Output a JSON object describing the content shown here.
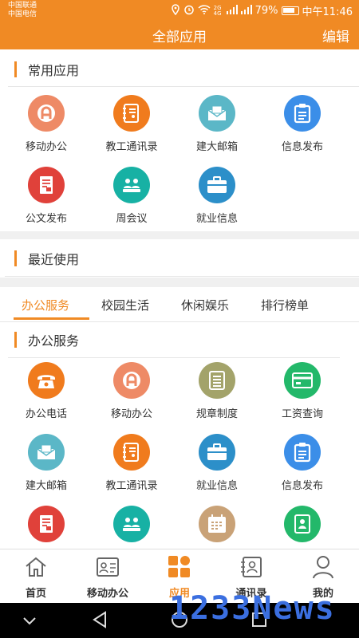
{
  "status": {
    "carrier1": "中国联通",
    "carrier2": "中国电信",
    "signal_tags": "2G 4G",
    "battery": "79%",
    "time": "中午11:46"
  },
  "header": {
    "title": "全部应用",
    "edit_label": "编辑"
  },
  "common": {
    "title": "常用应用",
    "apps": [
      {
        "label": "移动办公",
        "icon": "mobile-office-icon",
        "color": "#ee8a66"
      },
      {
        "label": "教工通讯录",
        "icon": "contacts-book-icon",
        "color": "#f07b1d"
      },
      {
        "label": "建大邮箱",
        "icon": "mail-icon",
        "color": "#5bb7c7"
      },
      {
        "label": "信息发布",
        "icon": "clipboard-icon",
        "color": "#3b8ee8"
      },
      {
        "label": "公文发布",
        "icon": "document-icon",
        "color": "#e0413a"
      },
      {
        "label": "周会议",
        "icon": "meeting-icon",
        "color": "#17b1a4"
      },
      {
        "label": "就业信息",
        "icon": "briefcase-icon",
        "color": "#2c8fc9"
      }
    ]
  },
  "recent": {
    "title": "最近使用"
  },
  "tabs": [
    {
      "label": "办公服务",
      "active": true
    },
    {
      "label": "校园生活",
      "active": false
    },
    {
      "label": "休闲娱乐",
      "active": false
    },
    {
      "label": "排行榜单",
      "active": false
    }
  ],
  "office": {
    "title": "办公服务",
    "apps": [
      {
        "label": "办公电话",
        "icon": "phone-icon",
        "color": "#f07b1d"
      },
      {
        "label": "移动办公",
        "icon": "mobile-office-icon",
        "color": "#ee8a66"
      },
      {
        "label": "规章制度",
        "icon": "rules-list-icon",
        "color": "#a3a36a"
      },
      {
        "label": "工资查询",
        "icon": "salary-card-icon",
        "color": "#23b86a"
      },
      {
        "label": "建大邮箱",
        "icon": "mail-icon",
        "color": "#5bb7c7"
      },
      {
        "label": "教工通讯录",
        "icon": "contacts-book-icon",
        "color": "#f07b1d"
      },
      {
        "label": "就业信息",
        "icon": "briefcase-icon",
        "color": "#2c8fc9"
      },
      {
        "label": "信息发布",
        "icon": "clipboard-icon",
        "color": "#3b8ee8"
      },
      {
        "label": "",
        "icon": "document-icon",
        "color": "#e0413a"
      },
      {
        "label": "",
        "icon": "meeting-icon",
        "color": "#17b1a4"
      },
      {
        "label": "",
        "icon": "calendar-icon",
        "color": "#c9a277"
      },
      {
        "label": "",
        "icon": "address-book-icon",
        "color": "#23b86a"
      }
    ]
  },
  "bottom_nav": [
    {
      "label": "首页",
      "icon": "home-icon",
      "active": false
    },
    {
      "label": "移动办公",
      "icon": "id-card-icon",
      "active": false
    },
    {
      "label": "应用",
      "icon": "apps-grid-icon",
      "active": true
    },
    {
      "label": "通讯录",
      "icon": "contacts-icon",
      "active": false
    },
    {
      "label": "我的",
      "icon": "user-icon",
      "active": false
    }
  ],
  "watermark": "1233News",
  "colors": {
    "accent": "#f08a24"
  }
}
